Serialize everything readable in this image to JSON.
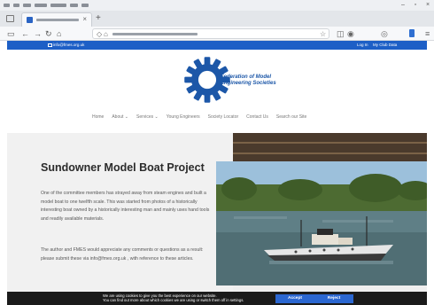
{
  "browser": {
    "tab_title": "",
    "url": "",
    "menu": [
      "",
      "",
      "",
      "",
      "",
      ""
    ]
  },
  "site": {
    "email": "info@fmes.org.uk",
    "login": "Log In",
    "club_data": "My Club Data",
    "logo_line1": "Federation of Model",
    "logo_line2": "Engineering Societies",
    "nav": [
      "Home",
      "About ⌄",
      "Services ⌄",
      "Young Engineers",
      "Society Locator",
      "Contact Us",
      "Search our Site"
    ],
    "brand_color": "#1d5fc6"
  },
  "hero": {
    "title": "Sundowner Model Boat Project",
    "para1": "One of the committee members has strayed away from steam engines and built a model boat to one twelfth scale. This was started from photos of a historically interesting boat owned by a historically interesting man and mainly uses hand tools and readily available materials.",
    "para2": "The author and FMES would appreciate any comments or questions as a result: please submit these via info@fmes.org.uk , with reference to these articles."
  },
  "cookie": {
    "line1": "We are using cookies to give you the best experience on our website.",
    "line2": "You can find out more about which cookies we are using or switch them off in settings.",
    "accept": "Accept",
    "reject": "Reject"
  }
}
